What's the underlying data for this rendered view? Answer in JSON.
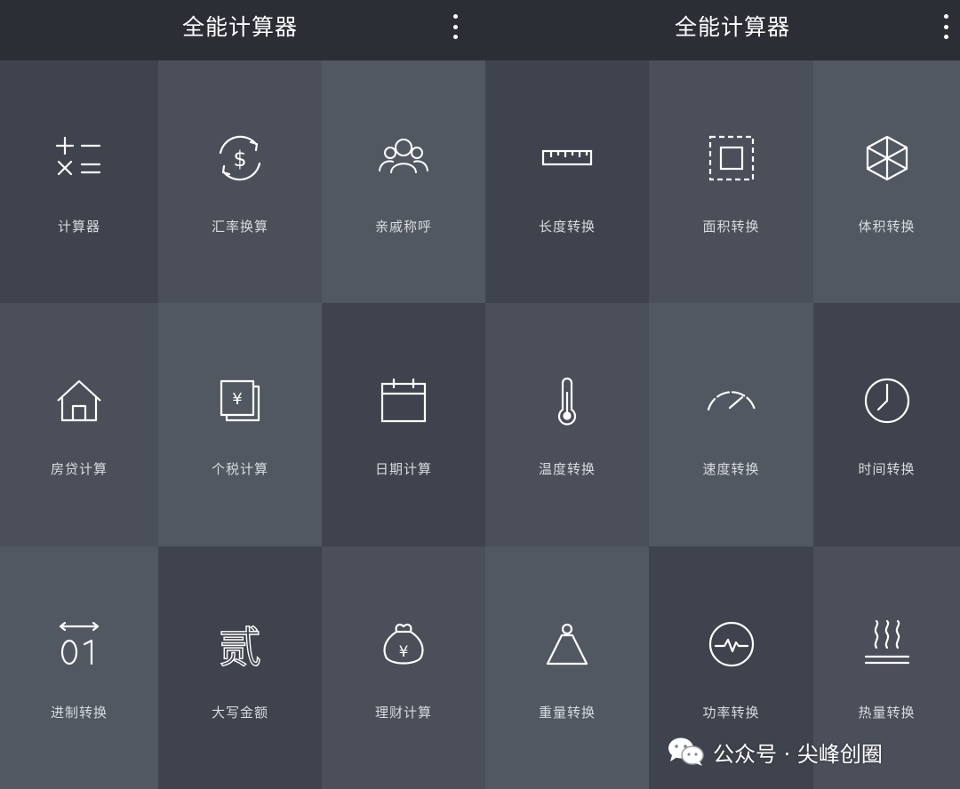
{
  "left": {
    "title": "全能计算器",
    "tiles": [
      {
        "label": "计算器",
        "icon": "calculator-ops-icon",
        "bg": "#3f434d"
      },
      {
        "label": "汇率换算",
        "icon": "currency-exchange-icon",
        "bg": "#4a4f59"
      },
      {
        "label": "亲戚称呼",
        "icon": "relatives-group-icon",
        "bg": "#525862"
      },
      {
        "label": "房贷计算",
        "icon": "house-icon",
        "bg": "#4a4f59"
      },
      {
        "label": "个税计算",
        "icon": "tax-document-icon",
        "bg": "#525862"
      },
      {
        "label": "日期计算",
        "icon": "calendar-icon",
        "bg": "#3f434d"
      },
      {
        "label": "进制转换",
        "icon": "binary-icon",
        "bg": "#525862"
      },
      {
        "label": "大写金额",
        "icon": "chinese-numeral-icon",
        "bg": "#3f434d"
      },
      {
        "label": "理财计算",
        "icon": "money-bag-icon",
        "bg": "#4a4f59"
      }
    ]
  },
  "right": {
    "title": "全能计算器",
    "tiles": [
      {
        "label": "长度转换",
        "icon": "ruler-icon",
        "bg": "#3f434d"
      },
      {
        "label": "面积转换",
        "icon": "area-icon",
        "bg": "#4a4f59"
      },
      {
        "label": "体积转换",
        "icon": "cube-icon",
        "bg": "#525862"
      },
      {
        "label": "温度转换",
        "icon": "thermometer-icon",
        "bg": "#4a4f59"
      },
      {
        "label": "速度转换",
        "icon": "speedometer-icon",
        "bg": "#525862"
      },
      {
        "label": "时间转换",
        "icon": "clock-icon",
        "bg": "#3f434d"
      },
      {
        "label": "重量转换",
        "icon": "weight-icon",
        "bg": "#525862"
      },
      {
        "label": "功率转换",
        "icon": "power-pulse-icon",
        "bg": "#3f434d"
      },
      {
        "label": "热量转换",
        "icon": "heat-icon",
        "bg": "#4a4f59"
      }
    ]
  },
  "watermark": {
    "text": "公众号 · 尖峰创圈",
    "icon": "wechat-icon"
  }
}
